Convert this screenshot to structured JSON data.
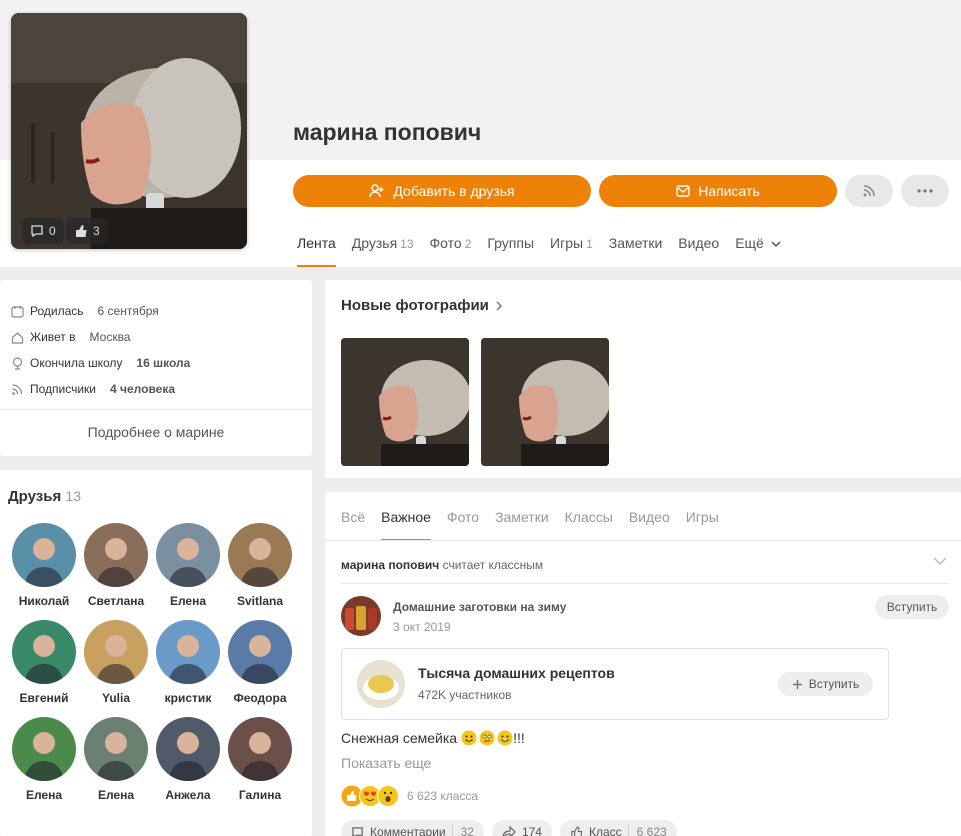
{
  "profile": {
    "name": "марина попович",
    "avatar_comments": "0",
    "avatar_likes": "3"
  },
  "actions": {
    "add_friend": "Добавить в друзья",
    "write": "Написать"
  },
  "profile_tabs": [
    {
      "label": "Лента",
      "count": ""
    },
    {
      "label": "Друзья",
      "count": "13"
    },
    {
      "label": "Фото",
      "count": "2"
    },
    {
      "label": "Группы",
      "count": ""
    },
    {
      "label": "Игры",
      "count": "1"
    },
    {
      "label": "Заметки",
      "count": ""
    },
    {
      "label": "Видео",
      "count": ""
    },
    {
      "label": "Ещё",
      "count": ""
    }
  ],
  "about": {
    "rows": [
      {
        "icon": "calendar-icon",
        "label": "Родилась",
        "value": "6 сентября"
      },
      {
        "icon": "home-icon",
        "label": "Живет в",
        "value": "Москва"
      },
      {
        "icon": "school-icon",
        "label": "Окончила школу",
        "value": "16 школа"
      },
      {
        "icon": "subscribers-icon",
        "label": "Подписчики",
        "value": "4 человека"
      }
    ],
    "more_link": "Подробнее о марине"
  },
  "friends": {
    "title": "Друзья",
    "count": "13",
    "items": [
      {
        "name": "Николай",
        "color": "#5a8fa8"
      },
      {
        "name": "Светлана",
        "color": "#8a6e5a"
      },
      {
        "name": "Елена",
        "color": "#7a8fa0"
      },
      {
        "name": "Svitlana",
        "color": "#9a7a55"
      },
      {
        "name": "Евгений",
        "color": "#3a8a6a"
      },
      {
        "name": "Yulia",
        "color": "#c8a060"
      },
      {
        "name": "кристик",
        "color": "#6a9ac8"
      },
      {
        "name": "Феодора",
        "color": "#5a7aa8"
      },
      {
        "name": "Елена",
        "color": "#4a8a4a"
      },
      {
        "name": "Елена",
        "color": "#6a8070"
      },
      {
        "name": "Анжела",
        "color": "#505a68"
      },
      {
        "name": "Галина",
        "color": "#6a5048"
      }
    ]
  },
  "new_photos": {
    "title": "Новые фотографии"
  },
  "feed_tabs": [
    "Всё",
    "Важное",
    "Фото",
    "Заметки",
    "Классы",
    "Видео",
    "Игры"
  ],
  "feed": {
    "actor": "марина попович",
    "action": "считает классным",
    "group_name": "Домашние заготовки на зиму",
    "date": "3 окт 2019",
    "join_label": "Вступить",
    "embedded_group": {
      "name": "Тысяча домашних рецептов",
      "members": "472K участников",
      "join_label": "Вступить"
    },
    "post_text": "Снежная семейка",
    "post_suffix": "!!!",
    "show_more": "Показать еще",
    "reactions_count": "6 623 класса",
    "comments_label": "Комментарии",
    "comments_count": "32",
    "shares_count": "174",
    "class_label": "Класс",
    "class_count": "6 623"
  },
  "colors": {
    "accent": "#ee8208",
    "background": "#eeeeee"
  }
}
